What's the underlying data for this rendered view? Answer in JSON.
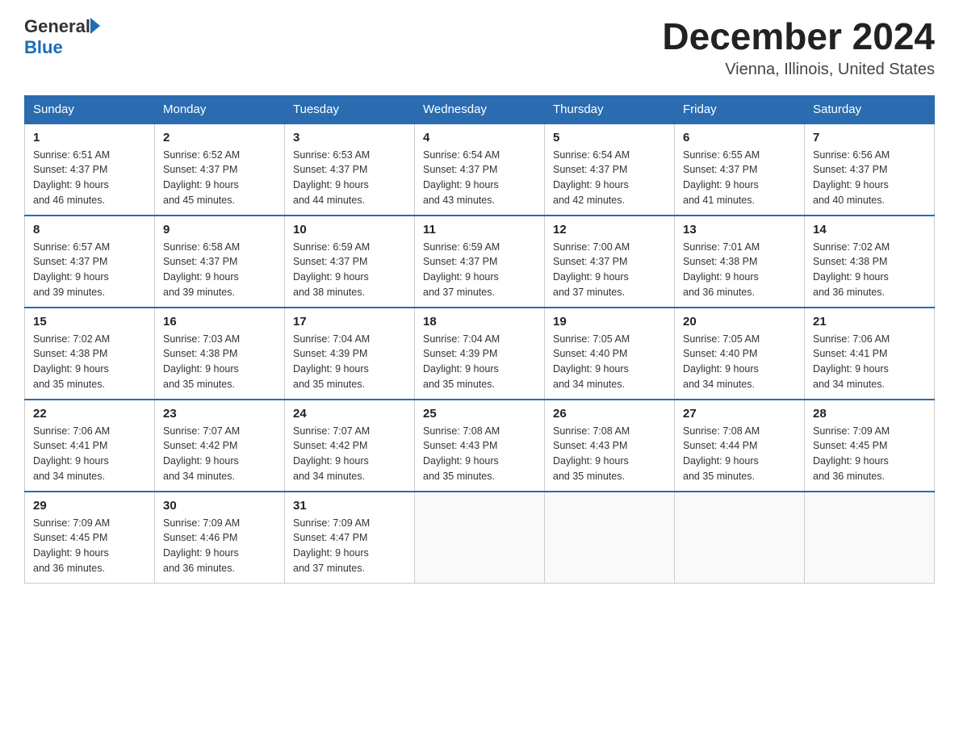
{
  "logo": {
    "general": "General",
    "blue": "Blue"
  },
  "title": "December 2024",
  "location": "Vienna, Illinois, United States",
  "days_of_week": [
    "Sunday",
    "Monday",
    "Tuesday",
    "Wednesday",
    "Thursday",
    "Friday",
    "Saturday"
  ],
  "weeks": [
    [
      {
        "day": "1",
        "sunrise": "6:51 AM",
        "sunset": "4:37 PM",
        "daylight": "9 hours and 46 minutes."
      },
      {
        "day": "2",
        "sunrise": "6:52 AM",
        "sunset": "4:37 PM",
        "daylight": "9 hours and 45 minutes."
      },
      {
        "day": "3",
        "sunrise": "6:53 AM",
        "sunset": "4:37 PM",
        "daylight": "9 hours and 44 minutes."
      },
      {
        "day": "4",
        "sunrise": "6:54 AM",
        "sunset": "4:37 PM",
        "daylight": "9 hours and 43 minutes."
      },
      {
        "day": "5",
        "sunrise": "6:54 AM",
        "sunset": "4:37 PM",
        "daylight": "9 hours and 42 minutes."
      },
      {
        "day": "6",
        "sunrise": "6:55 AM",
        "sunset": "4:37 PM",
        "daylight": "9 hours and 41 minutes."
      },
      {
        "day": "7",
        "sunrise": "6:56 AM",
        "sunset": "4:37 PM",
        "daylight": "9 hours and 40 minutes."
      }
    ],
    [
      {
        "day": "8",
        "sunrise": "6:57 AM",
        "sunset": "4:37 PM",
        "daylight": "9 hours and 39 minutes."
      },
      {
        "day": "9",
        "sunrise": "6:58 AM",
        "sunset": "4:37 PM",
        "daylight": "9 hours and 39 minutes."
      },
      {
        "day": "10",
        "sunrise": "6:59 AM",
        "sunset": "4:37 PM",
        "daylight": "9 hours and 38 minutes."
      },
      {
        "day": "11",
        "sunrise": "6:59 AM",
        "sunset": "4:37 PM",
        "daylight": "9 hours and 37 minutes."
      },
      {
        "day": "12",
        "sunrise": "7:00 AM",
        "sunset": "4:37 PM",
        "daylight": "9 hours and 37 minutes."
      },
      {
        "day": "13",
        "sunrise": "7:01 AM",
        "sunset": "4:38 PM",
        "daylight": "9 hours and 36 minutes."
      },
      {
        "day": "14",
        "sunrise": "7:02 AM",
        "sunset": "4:38 PM",
        "daylight": "9 hours and 36 minutes."
      }
    ],
    [
      {
        "day": "15",
        "sunrise": "7:02 AM",
        "sunset": "4:38 PM",
        "daylight": "9 hours and 35 minutes."
      },
      {
        "day": "16",
        "sunrise": "7:03 AM",
        "sunset": "4:38 PM",
        "daylight": "9 hours and 35 minutes."
      },
      {
        "day": "17",
        "sunrise": "7:04 AM",
        "sunset": "4:39 PM",
        "daylight": "9 hours and 35 minutes."
      },
      {
        "day": "18",
        "sunrise": "7:04 AM",
        "sunset": "4:39 PM",
        "daylight": "9 hours and 35 minutes."
      },
      {
        "day": "19",
        "sunrise": "7:05 AM",
        "sunset": "4:40 PM",
        "daylight": "9 hours and 34 minutes."
      },
      {
        "day": "20",
        "sunrise": "7:05 AM",
        "sunset": "4:40 PM",
        "daylight": "9 hours and 34 minutes."
      },
      {
        "day": "21",
        "sunrise": "7:06 AM",
        "sunset": "4:41 PM",
        "daylight": "9 hours and 34 minutes."
      }
    ],
    [
      {
        "day": "22",
        "sunrise": "7:06 AM",
        "sunset": "4:41 PM",
        "daylight": "9 hours and 34 minutes."
      },
      {
        "day": "23",
        "sunrise": "7:07 AM",
        "sunset": "4:42 PM",
        "daylight": "9 hours and 34 minutes."
      },
      {
        "day": "24",
        "sunrise": "7:07 AM",
        "sunset": "4:42 PM",
        "daylight": "9 hours and 34 minutes."
      },
      {
        "day": "25",
        "sunrise": "7:08 AM",
        "sunset": "4:43 PM",
        "daylight": "9 hours and 35 minutes."
      },
      {
        "day": "26",
        "sunrise": "7:08 AM",
        "sunset": "4:43 PM",
        "daylight": "9 hours and 35 minutes."
      },
      {
        "day": "27",
        "sunrise": "7:08 AM",
        "sunset": "4:44 PM",
        "daylight": "9 hours and 35 minutes."
      },
      {
        "day": "28",
        "sunrise": "7:09 AM",
        "sunset": "4:45 PM",
        "daylight": "9 hours and 36 minutes."
      }
    ],
    [
      {
        "day": "29",
        "sunrise": "7:09 AM",
        "sunset": "4:45 PM",
        "daylight": "9 hours and 36 minutes."
      },
      {
        "day": "30",
        "sunrise": "7:09 AM",
        "sunset": "4:46 PM",
        "daylight": "9 hours and 36 minutes."
      },
      {
        "day": "31",
        "sunrise": "7:09 AM",
        "sunset": "4:47 PM",
        "daylight": "9 hours and 37 minutes."
      },
      null,
      null,
      null,
      null
    ]
  ],
  "labels": {
    "sunrise": "Sunrise:",
    "sunset": "Sunset:",
    "daylight": "Daylight:"
  }
}
